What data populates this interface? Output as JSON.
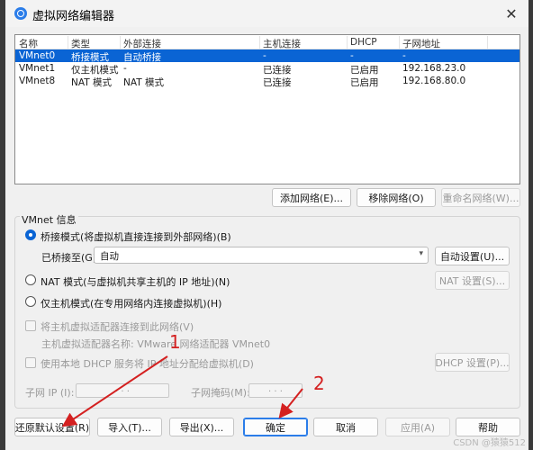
{
  "window": {
    "title": "虚拟网络编辑器",
    "close_glyph": "✕"
  },
  "table": {
    "columns": [
      "名称",
      "类型",
      "外部连接",
      "主机连接",
      "DHCP",
      "子网地址"
    ],
    "rows": [
      {
        "name": "VMnet0",
        "type": "桥接模式",
        "external": "自动桥接",
        "host": "-",
        "dhcp": "-",
        "subnet": "-",
        "selected": true
      },
      {
        "name": "VMnet1",
        "type": "仅主机模式",
        "external": "-",
        "host": "已连接",
        "dhcp": "已启用",
        "subnet": "192.168.23.0",
        "selected": false
      },
      {
        "name": "VMnet8",
        "type": "NAT 模式",
        "external": "NAT 模式",
        "host": "已连接",
        "dhcp": "已启用",
        "subnet": "192.168.80.0",
        "selected": false
      }
    ]
  },
  "network_buttons": {
    "add": "添加网络(E)...",
    "remove": "移除网络(O)",
    "rename": "重命名网络(W)..."
  },
  "vmnet_info": {
    "group_label": "VMnet 信息",
    "bridged_radio": "桥接模式(将虚拟机直接连接到外部网络)(B)",
    "bridged_to_label": "已桥接至(G):",
    "bridged_to_value": "自动",
    "auto_settings": "自动设置(U)...",
    "nat_radio": "NAT 模式(与虚拟机共享主机的 IP 地址)(N)",
    "nat_settings": "NAT 设置(S)...",
    "hostonly_radio": "仅主机模式(在专用网络内连接虚拟机)(H)",
    "connect_adapter_check": "将主机虚拟适配器连接到此网络(V)",
    "adapter_name": "主机虚拟适配器名称: VMware 网络适配器 VMnet0",
    "dhcp_check": "使用本地 DHCP 服务将 IP 地址分配给虚拟机(D)",
    "dhcp_settings": "DHCP 设置(P)...",
    "subnet_ip_label": "子网 IP (I):",
    "subnet_mask_label": "子网掩码(M):",
    "ip_dots": ".   .   ."
  },
  "footer": {
    "restore": "还原默认设置(R)",
    "import": "导入(T)...",
    "export": "导出(X)...",
    "ok": "确定",
    "cancel": "取消",
    "apply": "应用(A)",
    "help": "帮助"
  },
  "annotations": {
    "step1": "1",
    "step2": "2",
    "color": "#d42020"
  },
  "watermark": "CSDN @猿猿512",
  "colors": {
    "selection": "#0a64d4",
    "accent": "#2b7de9"
  }
}
